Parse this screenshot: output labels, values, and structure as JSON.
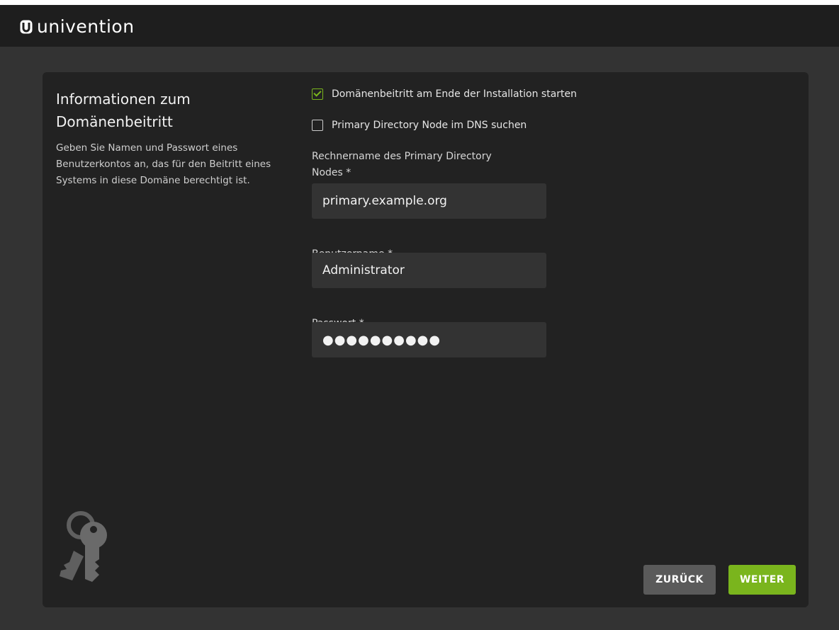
{
  "header": {
    "logo_text": "univention",
    "logo_icon": "univention-u-icon"
  },
  "info": {
    "title_line1": "Informationen zum",
    "title_line2": "Domänenbeitritt",
    "description": "Geben Sie Namen und Passwort eines Benutzerkontos an, das für den Beitritt eines Systems in diese Domäne berechtigt ist.",
    "illustration_icon": "keys-icon"
  },
  "form": {
    "join_at_end": {
      "label": "Domänenbeitritt am Ende der Installation starten",
      "checked": true
    },
    "search_dns": {
      "label": "Primary Directory Node im DNS suchen",
      "checked": false
    },
    "hostname": {
      "label_line1": "Rechnername des Primary Directory",
      "label_line2": "Nodes *",
      "value": "primary.example.org"
    },
    "username": {
      "label": "Benutzername *",
      "value": "Administrator"
    },
    "password": {
      "label": "Passwort *",
      "value": "●●●●●●●●●●"
    }
  },
  "buttons": {
    "back_label": "ZURÜCK",
    "next_label": "WEITER"
  },
  "colors": {
    "accent": "#7ab51d",
    "panel": "#222222",
    "background": "#333333",
    "topbar": "#1e1e1e",
    "back_button": "#5a5a5a"
  }
}
